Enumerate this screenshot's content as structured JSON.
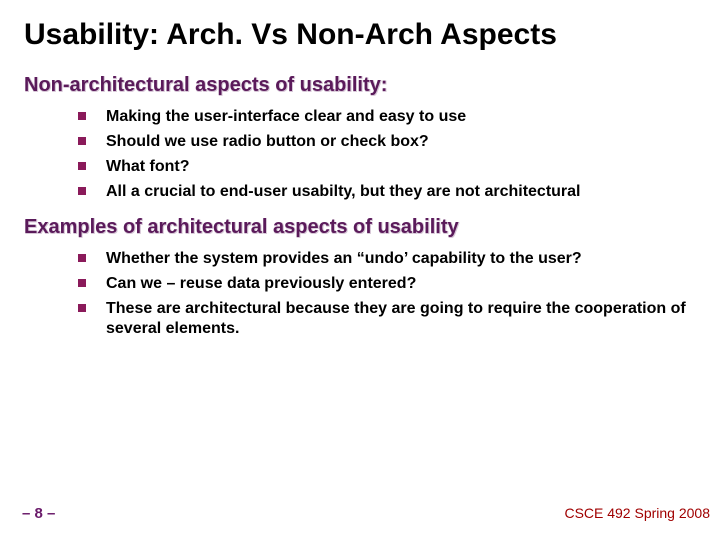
{
  "title": "Usability: Arch. Vs Non-Arch Aspects",
  "section1": {
    "heading": "Non-architectural aspects of usability:",
    "bullets": [
      "Making the user-interface clear and easy to use",
      "Should we use radio button or check box?",
      "What font?",
      "All a crucial to end-user usabilty, but they are not architectural"
    ]
  },
  "section2": {
    "heading": "Examples of architectural aspects of usability",
    "bullets": [
      "Whether the system provides an “undo’ capability to the user?",
      "Can we – reuse data previously entered?",
      "These are architectural because they are going to require the cooperation of several elements."
    ]
  },
  "footer": {
    "page": "– 8 –",
    "course": "CSCE 492 Spring 2008"
  }
}
